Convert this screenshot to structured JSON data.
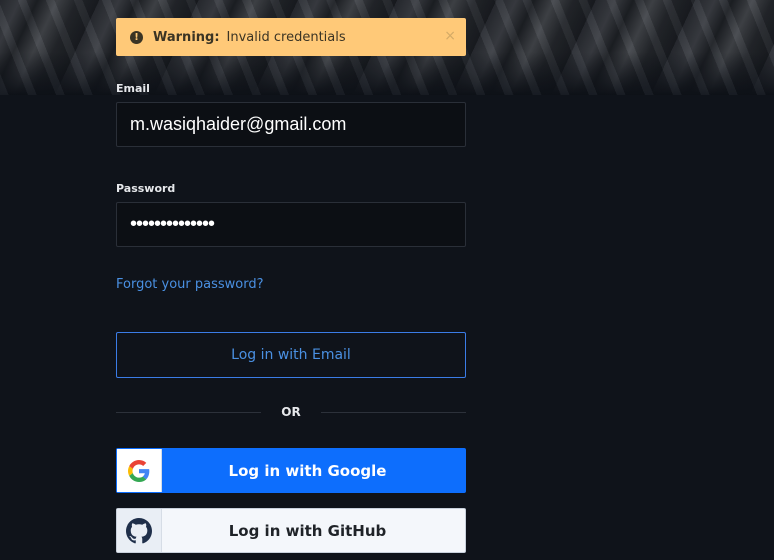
{
  "alert": {
    "title": "Warning:",
    "message": "Invalid credentials",
    "icon": "exclamation-circle-icon",
    "close": "×",
    "color": "#ffc978"
  },
  "form": {
    "email_label": "Email",
    "email_value": "m.wasiqhaider@gmail.com",
    "password_label": "Password",
    "password_value": "••••••••••••••",
    "forgot_link": "Forgot your password?"
  },
  "buttons": {
    "email_login": "Log in with Email",
    "divider": "OR",
    "google_login": "Log in with Google",
    "github_login": "Log in with GitHub"
  },
  "colors": {
    "accent": "#4a90e2",
    "google_button": "#0d6efd",
    "background": "#0f131a"
  }
}
